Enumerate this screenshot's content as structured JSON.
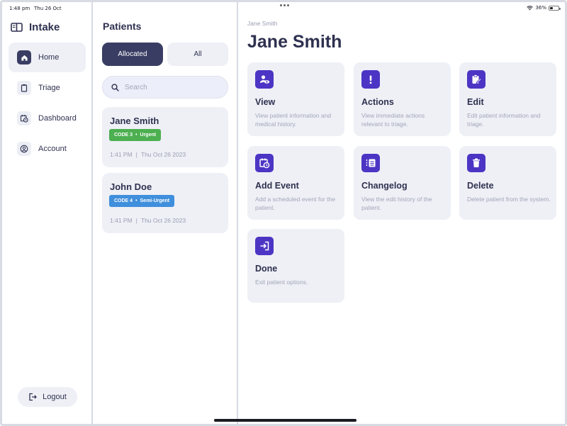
{
  "status_bar": {
    "time": "1:48 pm",
    "date": "Thu 26 Oct",
    "battery": "36%"
  },
  "app": {
    "title": "Intake"
  },
  "sidebar": {
    "items": [
      {
        "label": "Home",
        "icon": "home-icon",
        "active": true
      },
      {
        "label": "Triage",
        "icon": "clipboard-icon",
        "active": false
      },
      {
        "label": "Dashboard",
        "icon": "calendar-clock-icon",
        "active": false
      },
      {
        "label": "Account",
        "icon": "user-circle-icon",
        "active": false
      }
    ],
    "logout_label": "Logout"
  },
  "patients": {
    "title": "Patients",
    "filter_allocated": "Allocated",
    "filter_all": "All",
    "search_placeholder": "Search",
    "list": [
      {
        "name": "Jane Smith",
        "code": "CODE 3",
        "level": "Urgent",
        "badge_color": "#4caf50",
        "time": "1:41 PM",
        "date": "Thu Oct 26 2023"
      },
      {
        "name": "John Doe",
        "code": "CODE 4",
        "level": "Semi-Urgent",
        "badge_color": "#3f8fdc",
        "time": "1:41 PM",
        "date": "Thu Oct 26 2023"
      }
    ]
  },
  "main": {
    "breadcrumb": "Jane Smith",
    "title": "Jane Smith",
    "actions": [
      {
        "title": "View",
        "description": "View patient information and medical history.",
        "icon": "user-eye-icon"
      },
      {
        "title": "Actions",
        "description": "View immediate actions relevant to triage.",
        "icon": "exclamation-icon"
      },
      {
        "title": "Edit",
        "description": "Edit patient information and triage.",
        "icon": "clipboard-edit-icon"
      },
      {
        "title": "Add Event",
        "description": "Add a scheduled event for the patient.",
        "icon": "calendar-clock-icon"
      },
      {
        "title": "Changelog",
        "description": "View the edit history of the patient.",
        "icon": "list-icon"
      },
      {
        "title": "Delete",
        "description": "Delete patient from the system.",
        "icon": "trash-icon"
      },
      {
        "title": "Done",
        "description": "Exit patient options.",
        "icon": "exit-icon"
      }
    ]
  },
  "colors": {
    "accent": "#4c35c4",
    "primary_dark": "#3a3d63",
    "card_bg": "#eef0f6"
  }
}
